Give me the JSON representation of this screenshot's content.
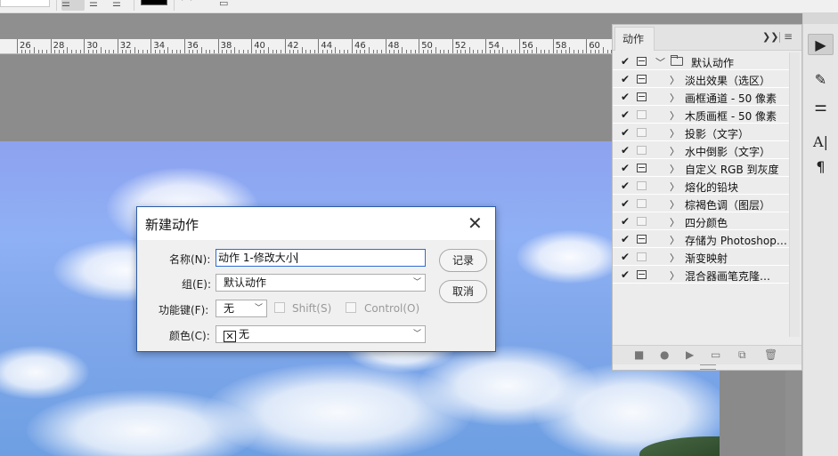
{
  "ruler": {
    "numbers": [
      "26",
      "28",
      "30",
      "32",
      "34",
      "36",
      "38",
      "40",
      "42",
      "44",
      "46",
      "48",
      "50",
      "52",
      "54",
      "56",
      "58",
      "60"
    ]
  },
  "actions_panel": {
    "tab": "动作",
    "items": [
      {
        "label": "默认动作",
        "checked": true,
        "dialog": true,
        "type": "folder"
      },
      {
        "label": "淡出效果（选区）",
        "checked": true,
        "dialog": true
      },
      {
        "label": "画框通道 - 50 像素",
        "checked": true,
        "dialog": true
      },
      {
        "label": "木质画框 - 50 像素",
        "checked": true,
        "dialog": false
      },
      {
        "label": "投影（文字）",
        "checked": true,
        "dialog": false
      },
      {
        "label": "水中倒影（文字）",
        "checked": true,
        "dialog": false
      },
      {
        "label": "自定义 RGB 到灰度",
        "checked": true,
        "dialog": true
      },
      {
        "label": "熔化的铅块",
        "checked": true,
        "dialog": false
      },
      {
        "label": "棕褐色调（图层）",
        "checked": true,
        "dialog": false
      },
      {
        "label": "四分颜色",
        "checked": true,
        "dialog": false
      },
      {
        "label": "存储为 Photoshop…",
        "checked": true,
        "dialog": true
      },
      {
        "label": "渐变映射",
        "checked": true,
        "dialog": false
      },
      {
        "label": "混合器画笔克隆…",
        "checked": true,
        "dialog": true
      }
    ]
  },
  "dialog": {
    "title": "新建动作",
    "name_label": "名称(N):",
    "name_value": "动作 1-修改大小",
    "group_label": "组(E):",
    "group_value": "默认动作",
    "fkey_label": "功能键(F):",
    "fkey_value": "无",
    "shift_label": "Shift(S)",
    "control_label": "Control(O)",
    "color_label": "颜色(C):",
    "color_value": "无",
    "record_label": "记录",
    "cancel_label": "取消"
  }
}
